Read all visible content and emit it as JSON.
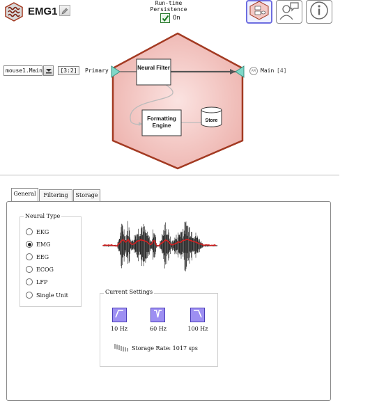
{
  "header": {
    "title": "EMG1",
    "persistence_label": "Run-time Persistence",
    "persistence_state": "On",
    "persistence_checked": true
  },
  "diagram": {
    "input_source": "mouse1.Main",
    "channel_range": "[3:2]",
    "input_label": "Primary",
    "filter_node": "Neural Filter",
    "format_node": "Formatting Engine",
    "store_node": "Store",
    "output_badge": "API",
    "output_label": "Main",
    "output_count": "[4]"
  },
  "tabs": [
    "General",
    "Filtering",
    "Storage"
  ],
  "active_tab": "General",
  "neural_type": {
    "title": "Neural Type",
    "options": [
      "EKG",
      "EMG",
      "EEG",
      "ECOG",
      "LFP",
      "Single Unit"
    ],
    "selected": "EMG"
  },
  "current_settings": {
    "title": "Current Settings",
    "filters": [
      {
        "label": "10 Hz",
        "icon": "highpass-filter-icon"
      },
      {
        "label": "60 Hz",
        "icon": "notch-filter-icon"
      },
      {
        "label": "100 Hz",
        "icon": "lowpass-filter-icon"
      }
    ],
    "storage_rate": "Storage Rate: 1017 sps"
  },
  "colors": {
    "hexagon_fill": "#f3c9c6",
    "hexagon_stroke": "#a33a22",
    "waveform_envelope": "#d62020",
    "filter_button": "#9d8ff2",
    "port": "#7fd8c8"
  }
}
